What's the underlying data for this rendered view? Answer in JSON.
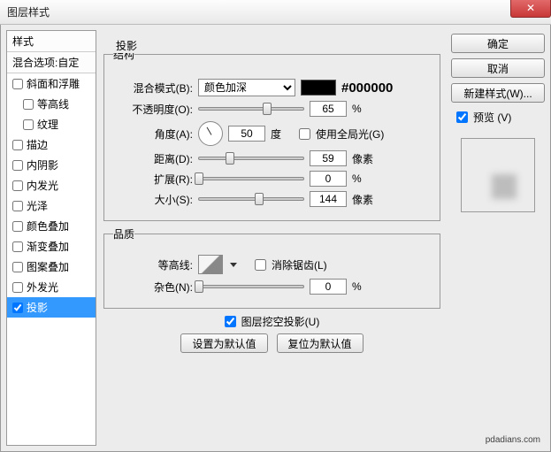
{
  "title": "图层样式",
  "close": "✕",
  "hex_label": "#000000",
  "styles": {
    "header": "样式",
    "blend": "混合选项:自定",
    "items": [
      {
        "label": "斜面和浮雕",
        "checked": false,
        "indent": false
      },
      {
        "label": "等高线",
        "checked": false,
        "indent": true
      },
      {
        "label": "纹理",
        "checked": false,
        "indent": true
      },
      {
        "label": "描边",
        "checked": false,
        "indent": false
      },
      {
        "label": "内阴影",
        "checked": false,
        "indent": false
      },
      {
        "label": "内发光",
        "checked": false,
        "indent": false
      },
      {
        "label": "光泽",
        "checked": false,
        "indent": false
      },
      {
        "label": "颜色叠加",
        "checked": false,
        "indent": false
      },
      {
        "label": "渐变叠加",
        "checked": false,
        "indent": false
      },
      {
        "label": "图案叠加",
        "checked": false,
        "indent": false
      },
      {
        "label": "外发光",
        "checked": false,
        "indent": false
      },
      {
        "label": "投影",
        "checked": true,
        "indent": false,
        "selected": true
      }
    ]
  },
  "panel": {
    "title": "投影",
    "structure": {
      "legend": "结构",
      "blend_mode_label": "混合模式(B):",
      "blend_mode_value": "颜色加深",
      "opacity_label": "不透明度(O):",
      "opacity_value": "65",
      "opacity_unit": "%",
      "angle_label": "角度(A):",
      "angle_value": "50",
      "angle_unit": "度",
      "global_light": "使用全局光(G)",
      "distance_label": "距离(D):",
      "distance_value": "59",
      "distance_unit": "像素",
      "spread_label": "扩展(R):",
      "spread_value": "0",
      "spread_unit": "%",
      "size_label": "大小(S):",
      "size_value": "144",
      "size_unit": "像素"
    },
    "quality": {
      "legend": "品质",
      "contour_label": "等高线:",
      "antialias": "消除锯齿(L)",
      "noise_label": "杂色(N):",
      "noise_value": "0",
      "noise_unit": "%"
    },
    "knockout": "图层挖空投影(U)",
    "set_default": "设置为默认值",
    "reset_default": "复位为默认值"
  },
  "right": {
    "ok": "确定",
    "cancel": "取消",
    "new_style": "新建样式(W)...",
    "preview": "预览 (V)"
  },
  "watermark": "pdadians.com"
}
